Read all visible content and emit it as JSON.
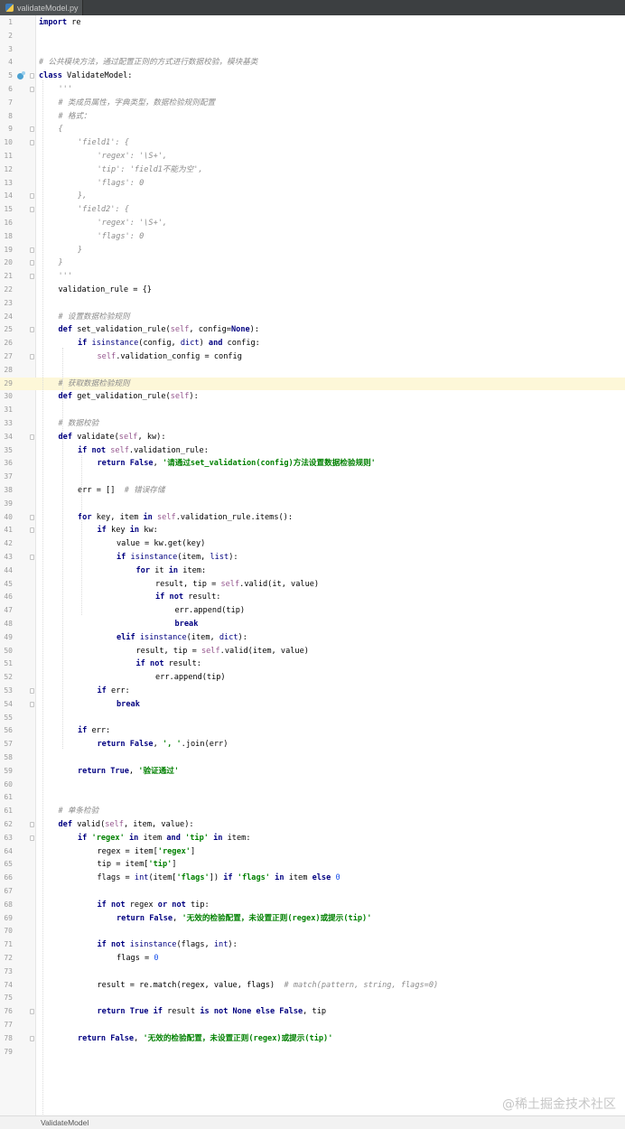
{
  "tab": {
    "file_name": "validateModel.py"
  },
  "statusbar": {
    "breadcrumb": "ValidateModel"
  },
  "watermark": "@稀土掘金技术社区",
  "highlight_line": 29,
  "bookmark_line": 5,
  "colors": {
    "keyword": "#000080",
    "string": "#008000",
    "comment": "#8c8c8c",
    "self": "#94558d",
    "number": "#1750eb",
    "highlight": "#fdf7d8"
  },
  "lines": [
    {
      "n": "1",
      "i": 0,
      "t": [
        [
          "k",
          "import"
        ],
        [
          "p",
          " re"
        ]
      ]
    },
    {
      "n": "2",
      "i": 0,
      "t": []
    },
    {
      "n": "3",
      "i": 0,
      "t": []
    },
    {
      "n": "4",
      "i": 0,
      "t": [
        [
          "c",
          "# 公共模块方法，通过配置正则的方式进行数据校验，模块基类"
        ]
      ]
    },
    {
      "n": "5",
      "i": 0,
      "t": [
        [
          "k",
          "class"
        ],
        [
          "p",
          " ValidateModel:"
        ]
      ]
    },
    {
      "n": "6",
      "i": 1,
      "t": [
        [
          "c",
          "'''"
        ]
      ]
    },
    {
      "n": "7",
      "i": 1,
      "t": [
        [
          "c",
          "# 类成员属性，字典类型，数据检验规则配置"
        ]
      ]
    },
    {
      "n": "8",
      "i": 1,
      "t": [
        [
          "c",
          "# 格式："
        ]
      ]
    },
    {
      "n": "9",
      "i": 1,
      "t": [
        [
          "c",
          "{"
        ]
      ]
    },
    {
      "n": "10",
      "i": 2,
      "t": [
        [
          "c",
          "'field1': {"
        ]
      ]
    },
    {
      "n": "11",
      "i": 3,
      "t": [
        [
          "c",
          "'regex': '\\S+',"
        ]
      ]
    },
    {
      "n": "12",
      "i": 3,
      "t": [
        [
          "c",
          "'tip': 'field1不能为空',"
        ]
      ]
    },
    {
      "n": "13",
      "i": 3,
      "t": [
        [
          "c",
          "'flags': 0"
        ]
      ]
    },
    {
      "n": "14",
      "i": 2,
      "t": [
        [
          "c",
          "},"
        ]
      ]
    },
    {
      "n": "15",
      "i": 2,
      "t": [
        [
          "c",
          "'field2': {"
        ]
      ]
    },
    {
      "n": "16",
      "i": 3,
      "t": [
        [
          "c",
          "'regex': '\\S+',"
        ]
      ]
    },
    {
      "n": "18",
      "i": 3,
      "t": [
        [
          "c",
          "'flags': 0"
        ]
      ]
    },
    {
      "n": "19",
      "i": 2,
      "t": [
        [
          "c",
          "}"
        ]
      ]
    },
    {
      "n": "20",
      "i": 1,
      "t": [
        [
          "c",
          "}"
        ]
      ]
    },
    {
      "n": "21",
      "i": 1,
      "t": [
        [
          "c",
          "'''"
        ]
      ]
    },
    {
      "n": "22",
      "i": 1,
      "t": [
        [
          "p",
          "validation_rule = {}"
        ]
      ]
    },
    {
      "n": "23",
      "i": 0,
      "t": []
    },
    {
      "n": "24",
      "i": 1,
      "t": [
        [
          "c",
          "# 设置数据检验规则"
        ]
      ]
    },
    {
      "n": "25",
      "i": 1,
      "t": [
        [
          "k",
          "def"
        ],
        [
          "p",
          " set_validation_rule("
        ],
        [
          "sf",
          "self"
        ],
        [
          "p",
          ", config="
        ],
        [
          "k",
          "None"
        ],
        [
          "p",
          "):"
        ]
      ]
    },
    {
      "n": "26",
      "i": 2,
      "t": [
        [
          "k",
          "if"
        ],
        [
          "b",
          " isinstance"
        ],
        [
          "p",
          "(config, "
        ],
        [
          "b",
          "dict"
        ],
        [
          "p",
          ") "
        ],
        [
          "k",
          "and"
        ],
        [
          "p",
          " config:"
        ]
      ]
    },
    {
      "n": "27",
      "i": 3,
      "t": [
        [
          "sf",
          "self"
        ],
        [
          "p",
          ".validation_config = config"
        ]
      ]
    },
    {
      "n": "28",
      "i": 0,
      "t": []
    },
    {
      "n": "29",
      "i": 1,
      "t": [
        [
          "c",
          "# 获取数据检验规则"
        ]
      ]
    },
    {
      "n": "30",
      "i": 1,
      "t": [
        [
          "k",
          "def"
        ],
        [
          "p",
          " get_validation_rule("
        ],
        [
          "sf",
          "self"
        ],
        [
          "p",
          "):"
        ]
      ]
    },
    {
      "n": "31",
      "i": 0,
      "t": []
    },
    {
      "n": "33",
      "i": 1,
      "t": [
        [
          "c",
          "# 数据校验"
        ]
      ]
    },
    {
      "n": "34",
      "i": 1,
      "t": [
        [
          "k",
          "def"
        ],
        [
          "p",
          " validate("
        ],
        [
          "sf",
          "self"
        ],
        [
          "p",
          ", kw):"
        ]
      ]
    },
    {
      "n": "35",
      "i": 2,
      "t": [
        [
          "k",
          "if not"
        ],
        [
          "sf",
          " self"
        ],
        [
          "p",
          ".validation_rule:"
        ]
      ]
    },
    {
      "n": "36",
      "i": 3,
      "t": [
        [
          "k",
          "return False"
        ],
        [
          "p",
          ", "
        ],
        [
          "s",
          "'请通过set_validation(config)方法设置数据检验规则'"
        ]
      ]
    },
    {
      "n": "37",
      "i": 0,
      "t": []
    },
    {
      "n": "38",
      "i": 2,
      "t": [
        [
          "p",
          "err = []  "
        ],
        [
          "c",
          "# 错误存储"
        ]
      ]
    },
    {
      "n": "39",
      "i": 0,
      "t": []
    },
    {
      "n": "40",
      "i": 2,
      "t": [
        [
          "k",
          "for"
        ],
        [
          "p",
          " key, item "
        ],
        [
          "k",
          "in"
        ],
        [
          "sf",
          " self"
        ],
        [
          "p",
          ".validation_rule.items():"
        ]
      ]
    },
    {
      "n": "41",
      "i": 3,
      "t": [
        [
          "k",
          "if"
        ],
        [
          "p",
          " key "
        ],
        [
          "k",
          "in"
        ],
        [
          "p",
          " kw:"
        ]
      ]
    },
    {
      "n": "42",
      "i": 4,
      "t": [
        [
          "p",
          "value = kw.get(key)"
        ]
      ]
    },
    {
      "n": "43",
      "i": 4,
      "t": [
        [
          "k",
          "if"
        ],
        [
          "b",
          " isinstance"
        ],
        [
          "p",
          "(item, "
        ],
        [
          "b",
          "list"
        ],
        [
          "p",
          "):"
        ]
      ]
    },
    {
      "n": "44",
      "i": 5,
      "t": [
        [
          "k",
          "for"
        ],
        [
          "p",
          " it "
        ],
        [
          "k",
          "in"
        ],
        [
          "p",
          " item:"
        ]
      ]
    },
    {
      "n": "45",
      "i": 6,
      "t": [
        [
          "p",
          "result, tip = "
        ],
        [
          "sf",
          "self"
        ],
        [
          "p",
          ".valid(it, value)"
        ]
      ]
    },
    {
      "n": "46",
      "i": 6,
      "t": [
        [
          "k",
          "if not"
        ],
        [
          "p",
          " result:"
        ]
      ]
    },
    {
      "n": "47",
      "i": 7,
      "t": [
        [
          "p",
          "err.append(tip)"
        ]
      ]
    },
    {
      "n": "48",
      "i": 7,
      "t": [
        [
          "k",
          "break"
        ]
      ]
    },
    {
      "n": "49",
      "i": 4,
      "t": [
        [
          "k",
          "elif"
        ],
        [
          "b",
          " isinstance"
        ],
        [
          "p",
          "(item, "
        ],
        [
          "b",
          "dict"
        ],
        [
          "p",
          "):"
        ]
      ]
    },
    {
      "n": "50",
      "i": 5,
      "t": [
        [
          "p",
          "result, tip = "
        ],
        [
          "sf",
          "self"
        ],
        [
          "p",
          ".valid(item, value)"
        ]
      ]
    },
    {
      "n": "51",
      "i": 5,
      "t": [
        [
          "k",
          "if not"
        ],
        [
          "p",
          " result:"
        ]
      ]
    },
    {
      "n": "52",
      "i": 6,
      "t": [
        [
          "p",
          "err.append(tip)"
        ]
      ]
    },
    {
      "n": "53",
      "i": 3,
      "t": [
        [
          "k",
          "if"
        ],
        [
          "p",
          " err:"
        ]
      ]
    },
    {
      "n": "54",
      "i": 4,
      "t": [
        [
          "k",
          "break"
        ]
      ]
    },
    {
      "n": "55",
      "i": 0,
      "t": []
    },
    {
      "n": "56",
      "i": 2,
      "t": [
        [
          "k",
          "if"
        ],
        [
          "p",
          " err:"
        ]
      ]
    },
    {
      "n": "57",
      "i": 3,
      "t": [
        [
          "k",
          "return False"
        ],
        [
          "p",
          ", "
        ],
        [
          "s",
          "', '"
        ],
        [
          "p",
          ".join(err)"
        ]
      ]
    },
    {
      "n": "58",
      "i": 0,
      "t": []
    },
    {
      "n": "59",
      "i": 2,
      "t": [
        [
          "k",
          "return True"
        ],
        [
          "p",
          ", "
        ],
        [
          "s",
          "'验证通过'"
        ]
      ]
    },
    {
      "n": "60",
      "i": 0,
      "t": []
    },
    {
      "n": "61",
      "i": 0,
      "t": []
    },
    {
      "n": "61",
      "i": 1,
      "t": [
        [
          "c",
          "# 单条检验"
        ]
      ]
    },
    {
      "n": "62",
      "i": 1,
      "t": [
        [
          "k",
          "def"
        ],
        [
          "p",
          " valid("
        ],
        [
          "sf",
          "self"
        ],
        [
          "p",
          ", item, value):"
        ]
      ]
    },
    {
      "n": "63",
      "i": 2,
      "t": [
        [
          "k",
          "if"
        ],
        [
          "s",
          " 'regex'"
        ],
        [
          "k",
          " in"
        ],
        [
          "p",
          " item "
        ],
        [
          "k",
          "and"
        ],
        [
          "s",
          " 'tip'"
        ],
        [
          "k",
          " in"
        ],
        [
          "p",
          " item:"
        ]
      ]
    },
    {
      "n": "64",
      "i": 3,
      "t": [
        [
          "p",
          "regex = item["
        ],
        [
          "s",
          "'regex'"
        ],
        [
          "p",
          "]"
        ]
      ]
    },
    {
      "n": "65",
      "i": 3,
      "t": [
        [
          "p",
          "tip = item["
        ],
        [
          "s",
          "'tip'"
        ],
        [
          "p",
          "]"
        ]
      ]
    },
    {
      "n": "66",
      "i": 3,
      "t": [
        [
          "p",
          "flags = "
        ],
        [
          "b",
          "int"
        ],
        [
          "p",
          "(item["
        ],
        [
          "s",
          "'flags'"
        ],
        [
          "p",
          "]) "
        ],
        [
          "k",
          "if"
        ],
        [
          "s",
          " 'flags'"
        ],
        [
          "k",
          " in"
        ],
        [
          "p",
          " item "
        ],
        [
          "k",
          "else"
        ],
        [
          "n",
          " 0"
        ]
      ]
    },
    {
      "n": "67",
      "i": 0,
      "t": []
    },
    {
      "n": "68",
      "i": 3,
      "t": [
        [
          "k",
          "if not"
        ],
        [
          "p",
          " regex "
        ],
        [
          "k",
          "or not"
        ],
        [
          "p",
          " tip:"
        ]
      ]
    },
    {
      "n": "69",
      "i": 4,
      "t": [
        [
          "k",
          "return False"
        ],
        [
          "p",
          ", "
        ],
        [
          "s",
          "'无效的检验配置，未设置正则(regex)或提示(tip)'"
        ]
      ]
    },
    {
      "n": "70",
      "i": 0,
      "t": []
    },
    {
      "n": "71",
      "i": 3,
      "t": [
        [
          "k",
          "if not"
        ],
        [
          "b",
          " isinstance"
        ],
        [
          "p",
          "(flags, "
        ],
        [
          "b",
          "int"
        ],
        [
          "p",
          "):"
        ]
      ]
    },
    {
      "n": "72",
      "i": 4,
      "t": [
        [
          "p",
          "flags = "
        ],
        [
          "n",
          "0"
        ]
      ]
    },
    {
      "n": "73",
      "i": 0,
      "t": []
    },
    {
      "n": "74",
      "i": 3,
      "t": [
        [
          "p",
          "result = re.match(regex, value, flags)  "
        ],
        [
          "c",
          "# match(pattern, string, flags=0)"
        ]
      ]
    },
    {
      "n": "75",
      "i": 0,
      "t": []
    },
    {
      "n": "76",
      "i": 3,
      "t": [
        [
          "k",
          "return True if"
        ],
        [
          "p",
          " result "
        ],
        [
          "k",
          "is not None else False"
        ],
        [
          "p",
          ", tip"
        ]
      ]
    },
    {
      "n": "77",
      "i": 0,
      "t": []
    },
    {
      "n": "78",
      "i": 2,
      "t": [
        [
          "k",
          "return False"
        ],
        [
          "p",
          ", "
        ],
        [
          "s",
          "'无效的检验配置，未设置正则(regex)或提示(tip)'"
        ]
      ]
    },
    {
      "n": "79",
      "i": 0,
      "t": []
    }
  ]
}
